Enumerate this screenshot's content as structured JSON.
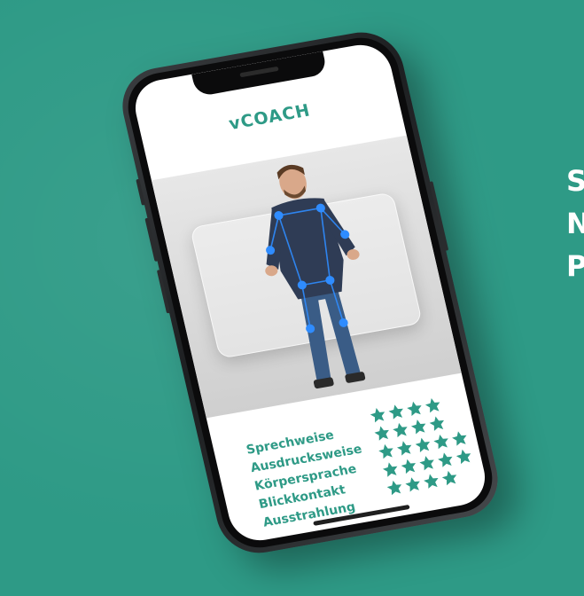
{
  "side_text": [
    "S",
    "N",
    "P"
  ],
  "app": {
    "title": "vCOACH"
  },
  "ratings": [
    {
      "label": "Sprechweise",
      "stars": 4
    },
    {
      "label": "Ausdrucksweise",
      "stars": 4
    },
    {
      "label": "Körpersprache",
      "stars": 5
    },
    {
      "label": "Blickkontakt",
      "stars": 5
    },
    {
      "label": "Ausstrahlung",
      "stars": 4
    }
  ],
  "colors": {
    "background": "#2e9a86",
    "accent": "#2e9a86",
    "skeleton": "#2f8cff"
  },
  "icons": {
    "rating_star": "star-icon"
  }
}
